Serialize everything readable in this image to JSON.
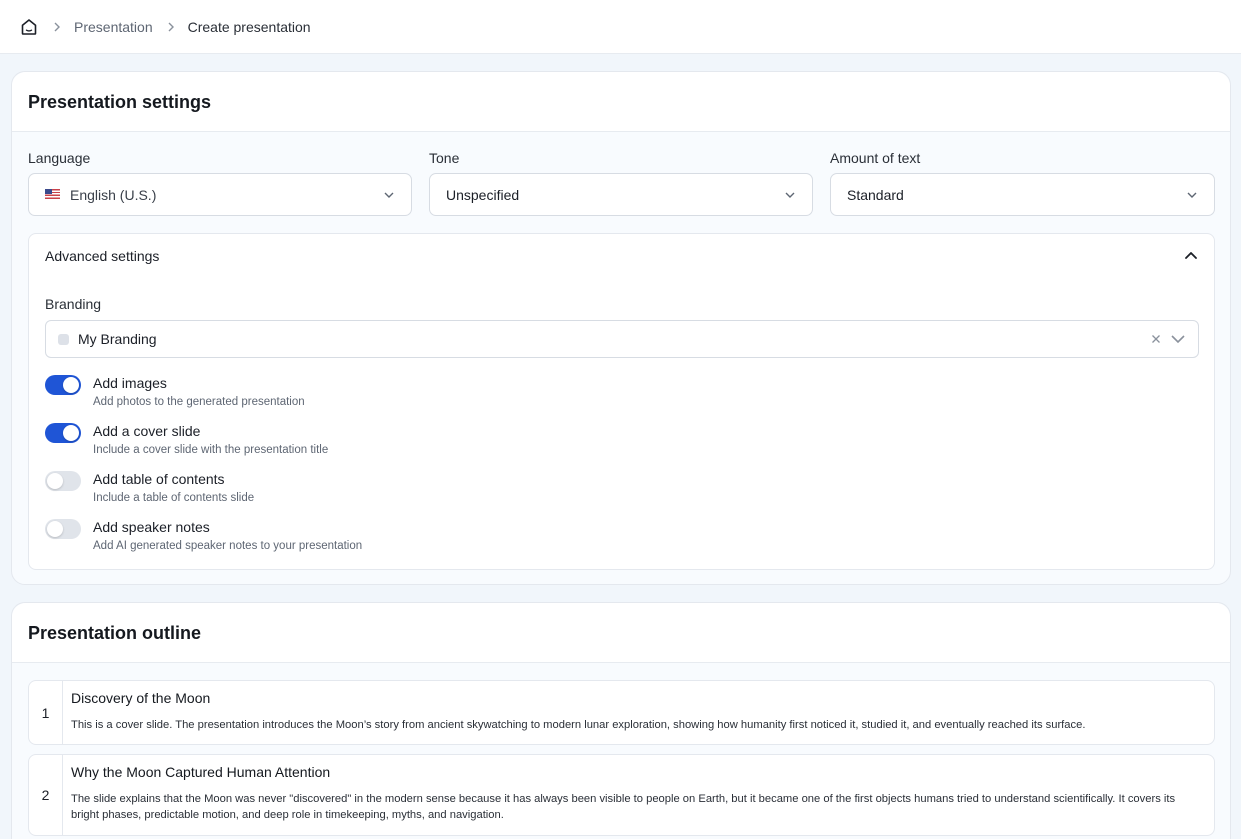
{
  "breadcrumb": {
    "home_icon": "home-icon",
    "items": [
      "Presentation",
      "Create presentation"
    ]
  },
  "settings": {
    "title": "Presentation settings",
    "language": {
      "label": "Language",
      "value": "English (U.S.)",
      "flag_icon": "us-flag-icon"
    },
    "tone": {
      "label": "Tone",
      "value": "Unspecified"
    },
    "amount": {
      "label": "Amount of text",
      "value": "Standard"
    },
    "advanced": {
      "title": "Advanced settings",
      "expanded": true,
      "branding": {
        "label": "Branding",
        "value": "My Branding"
      },
      "toggles": [
        {
          "title": "Add images",
          "desc": "Add photos to the generated presentation",
          "on": true
        },
        {
          "title": "Add a cover slide",
          "desc": "Include a cover slide with the presentation title",
          "on": true
        },
        {
          "title": "Add table of contents",
          "desc": "Include a table of contents slide",
          "on": false
        },
        {
          "title": "Add speaker notes",
          "desc": "Add AI generated speaker notes to your presentation",
          "on": false
        }
      ]
    }
  },
  "outline": {
    "title": "Presentation outline",
    "items": [
      {
        "num": "1",
        "title": "Discovery of the Moon",
        "desc": "This is a cover slide. The presentation introduces the Moon’s story from ancient skywatching to modern lunar exploration, showing how humanity first noticed it, studied it, and eventually reached its surface."
      },
      {
        "num": "2",
        "title": "Why the Moon Captured Human Attention",
        "desc": "The slide explains that the Moon was never \"discovered\" in the modern sense because it has always been visible to people on Earth, but it became one of the first objects humans tried to understand scientifically. It covers its bright phases, predictable motion, and deep role in timekeeping, myths, and navigation."
      }
    ]
  },
  "colors": {
    "accent": "#1f55d6",
    "toggle_off": "#e0e4ea",
    "page_bg": "#f1f6fb"
  }
}
